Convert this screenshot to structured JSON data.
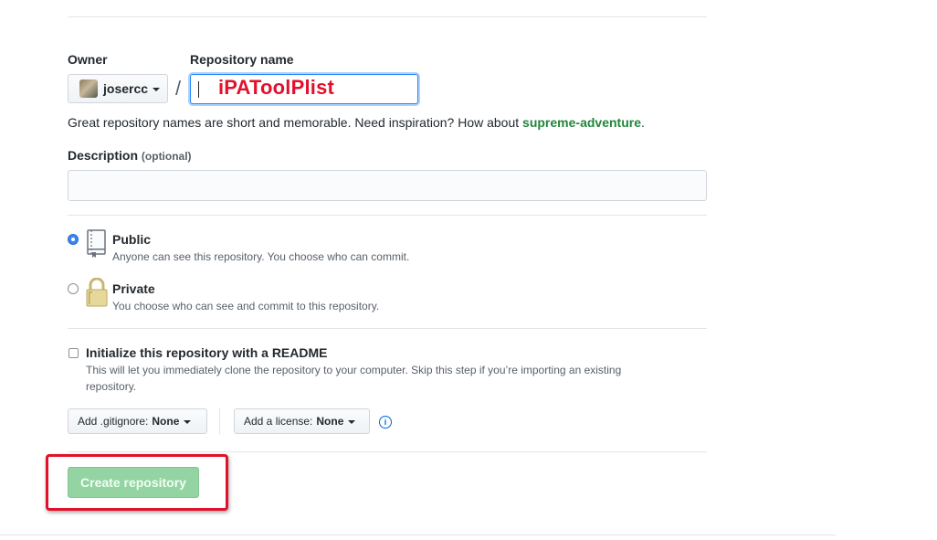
{
  "owner": {
    "label": "Owner",
    "username": "josercc"
  },
  "repo": {
    "label": "Repository name",
    "slash": "/",
    "annotation_text": "iPAToolPlist",
    "value": ""
  },
  "hint": {
    "text": "Great repository names are short and memorable. Need inspiration? How about ",
    "suggestion": "supreme-adventure",
    "suffix": "."
  },
  "description": {
    "label": "Description",
    "optional": "(optional)",
    "value": ""
  },
  "visibility": {
    "public": {
      "title": "Public",
      "desc": "Anyone can see this repository. You choose who can commit.",
      "checked": true
    },
    "private": {
      "title": "Private",
      "desc": "You choose who can see and commit to this repository.",
      "checked": false
    }
  },
  "readme": {
    "title": "Initialize this repository with a README",
    "desc_line1": "This will let you immediately clone the repository to your computer. Skip this step if you’re importing an existing",
    "desc_line2": "repository.",
    "checked": false
  },
  "gitignore": {
    "label": "Add .gitignore:",
    "value": "None"
  },
  "license": {
    "label": "Add a license:",
    "value": "None"
  },
  "info_icon": "i",
  "create_button": "Create repository",
  "colors": {
    "accent": "#2188ff",
    "suggestion_green": "#22863a",
    "annotation_red": "#e3102b",
    "button_disabled_green": "#94d3a2"
  }
}
